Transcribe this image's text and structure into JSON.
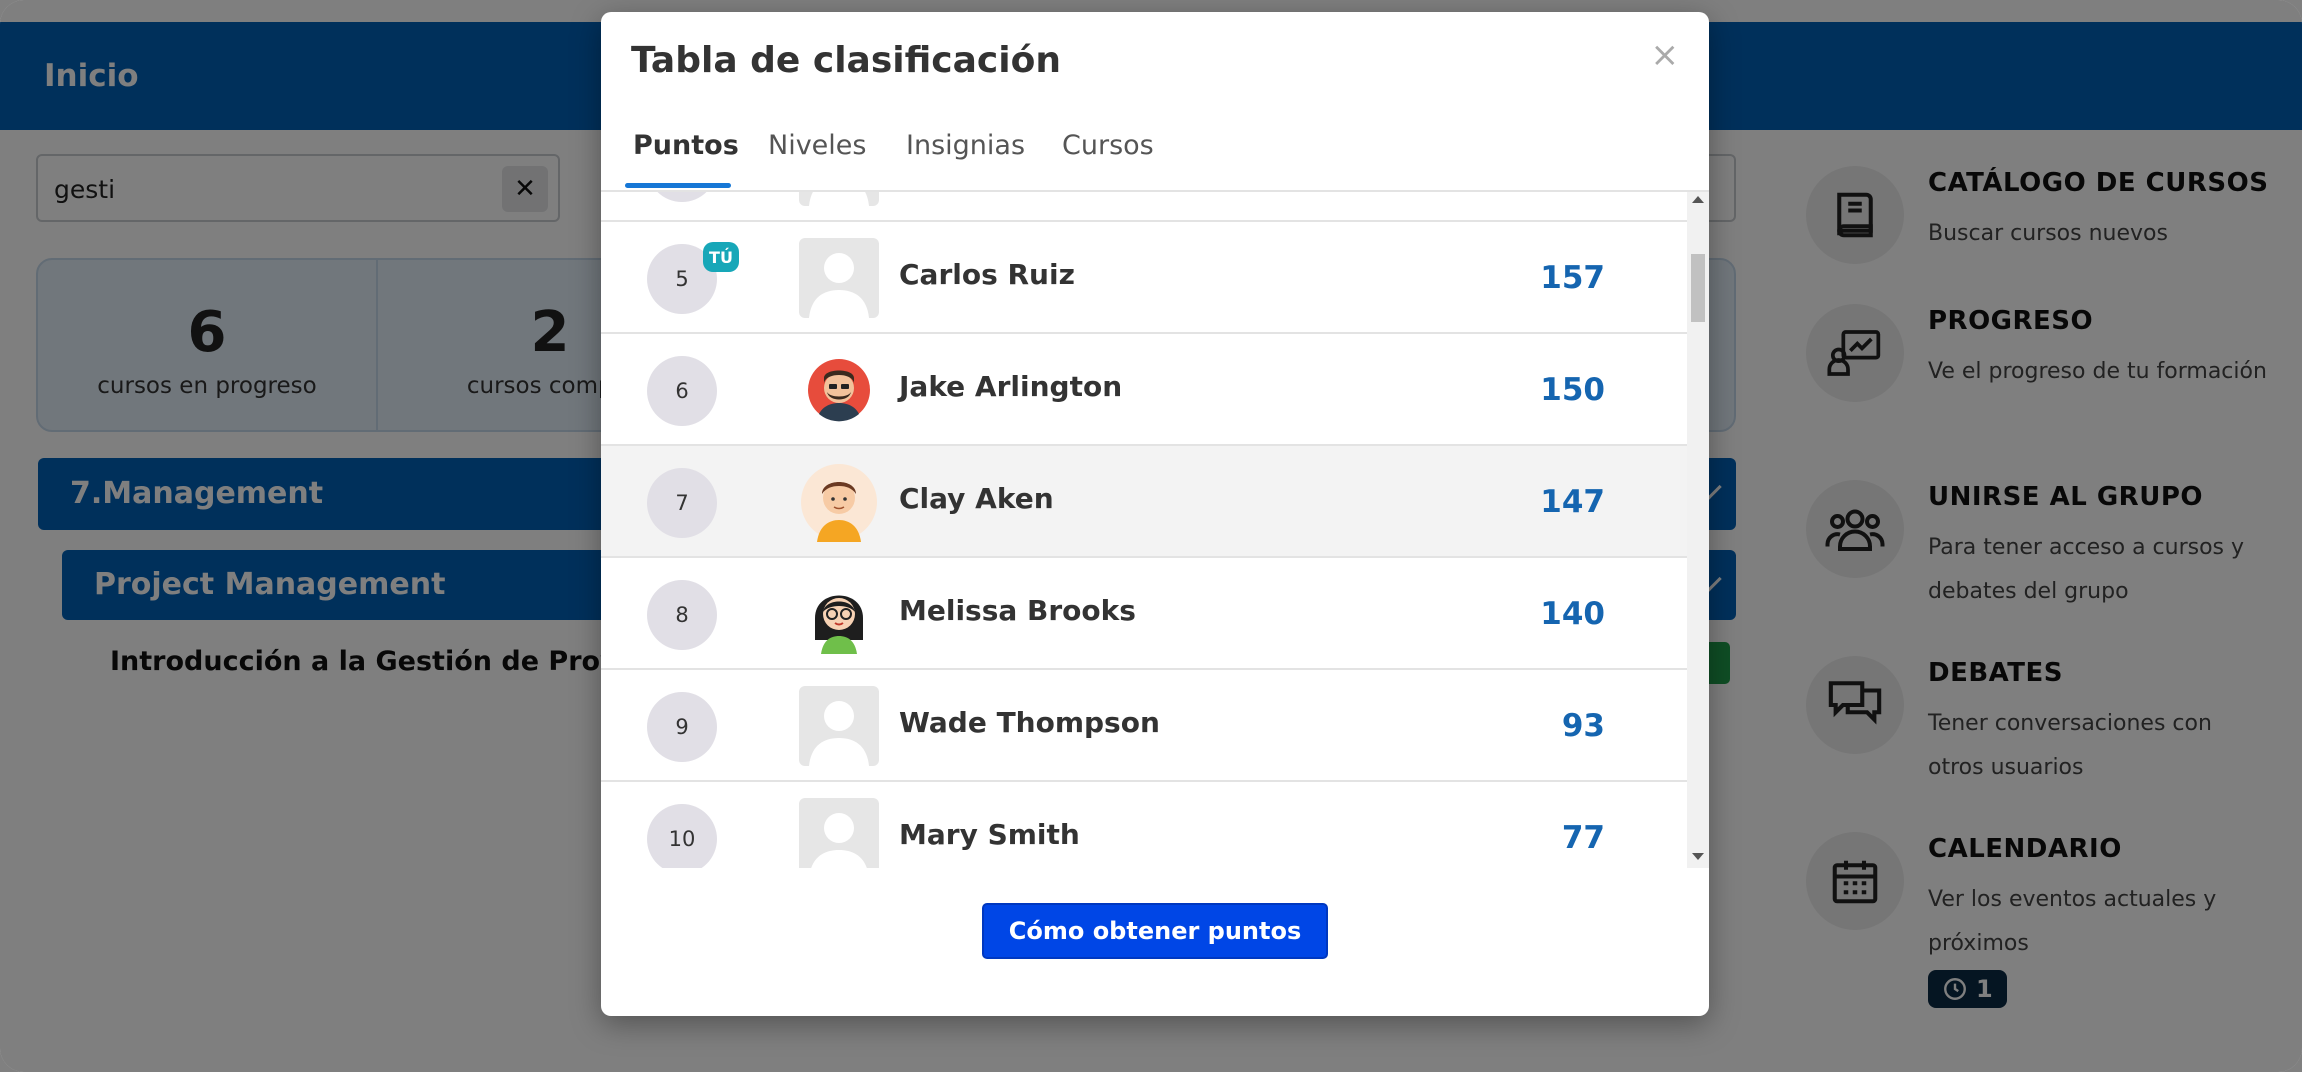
{
  "header": {
    "title": "Inicio"
  },
  "search": {
    "value": "gesti",
    "clear_label": "✕"
  },
  "stats": [
    {
      "value": "6",
      "label": "cursos en progreso"
    },
    {
      "value": "2",
      "label": "cursos comple"
    }
  ],
  "categories": {
    "main": "7.Management",
    "sub": "Project Management",
    "course": "Introducción a la Gestión de Proyect"
  },
  "sidebar": [
    {
      "icon": "book-icon",
      "title": "CATÁLOGO DE CURSOS",
      "desc": "Buscar cursos nuevos"
    },
    {
      "icon": "progress-icon",
      "title": "PROGRESO",
      "desc": "Ve el progreso de tu formación"
    },
    {
      "icon": "group-icon",
      "title": "UNIRSE AL GRUPO",
      "desc": "Para tener acceso a cursos y debates del grupo"
    },
    {
      "icon": "chat-icon",
      "title": "DEBATES",
      "desc": "Tener conversaciones con otros usuarios"
    },
    {
      "icon": "calendar-icon",
      "title": "CALENDARIO",
      "desc": "Ver los eventos actuales y próximos",
      "badge": "1"
    }
  ],
  "modal": {
    "title": "Tabla de clasificación",
    "close": "×",
    "tabs": [
      {
        "label": "Puntos",
        "active": true
      },
      {
        "label": "Niveles"
      },
      {
        "label": "Insignias"
      },
      {
        "label": "Cursos"
      }
    ],
    "you_label": "TÚ",
    "leaderboard": [
      {
        "rank": "5",
        "name": "Carlos Ruiz",
        "points": "157",
        "you": true,
        "avatar": "placeholder"
      },
      {
        "rank": "6",
        "name": "Jake Arlington",
        "points": "150",
        "avatar": "bearded-man"
      },
      {
        "rank": "7",
        "name": "Clay Aken",
        "points": "147",
        "avatar": "young-man",
        "highlight": true
      },
      {
        "rank": "8",
        "name": "Melissa Brooks",
        "points": "140",
        "avatar": "woman-glasses"
      },
      {
        "rank": "9",
        "name": "Wade Thompson",
        "points": "93",
        "avatar": "placeholder"
      },
      {
        "rank": "10",
        "name": "Mary Smith",
        "points": "77",
        "avatar": "placeholder"
      }
    ],
    "button_label": "Cómo obtener puntos"
  },
  "colors": {
    "primary": "#0160b6",
    "points": "#1565b0",
    "button": "#0046e6",
    "you_badge": "#17a7b8"
  }
}
